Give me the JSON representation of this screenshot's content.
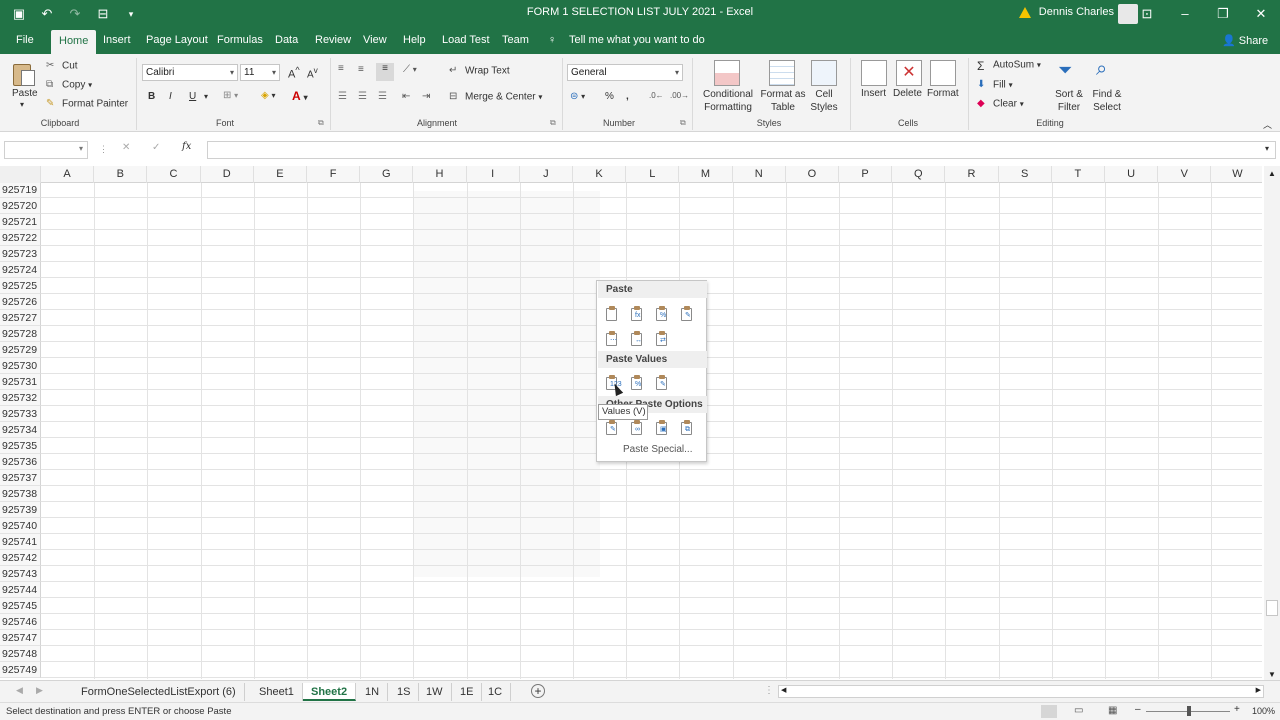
{
  "titlebar": {
    "title": "FORM 1 SELECTION LIST JULY 2021  -  Excel",
    "user": "Dennis Charles",
    "accent": "#217346"
  },
  "tabs": [
    "File",
    "Home",
    "Insert",
    "Page Layout",
    "Formulas",
    "Data",
    "Review",
    "View",
    "Help",
    "Load Test",
    "Team"
  ],
  "tell_me": "Tell me what you want to do",
  "share": "Share",
  "ribbon": {
    "clipboard": {
      "paste": "Paste",
      "cut": "Cut",
      "copy": "Copy",
      "format_painter": "Format Painter",
      "label": "Clipboard"
    },
    "font": {
      "name": "Calibri",
      "size": "11",
      "bold": "B",
      "italic": "I",
      "underline": "U",
      "label": "Font"
    },
    "alignment": {
      "wrap": "Wrap Text",
      "merge": "Merge & Center",
      "label": "Alignment"
    },
    "number": {
      "format": "General",
      "label": "Number"
    },
    "styles": {
      "conditional": "Conditional Formatting",
      "format_table": "Format as Table",
      "cell_styles": "Cell Styles",
      "label": "Styles"
    },
    "cells": {
      "insert": "Insert",
      "delete": "Delete",
      "format": "Format",
      "label": "Cells"
    },
    "editing": {
      "autosum": "AutoSum",
      "fill": "Fill",
      "clear": "Clear",
      "sort": "Sort & Filter",
      "find": "Find & Select",
      "label": "Editing"
    }
  },
  "formula_bar": {
    "name_box": "",
    "fx": "fx",
    "content": ""
  },
  "columns": [
    "A",
    "B",
    "C",
    "D",
    "E",
    "F",
    "G",
    "H",
    "I",
    "J",
    "K",
    "L",
    "M",
    "N",
    "O",
    "P",
    "Q",
    "R",
    "S",
    "T",
    "U",
    "V",
    "W"
  ],
  "rows": [
    "925719",
    "925720",
    "925721",
    "925722",
    "925723",
    "925724",
    "925725",
    "925726",
    "925727",
    "925728",
    "925729",
    "925730",
    "925731",
    "925732",
    "925733",
    "925734",
    "925735",
    "925736",
    "925737",
    "925738",
    "925739",
    "925740",
    "925741",
    "925742",
    "925743",
    "925744",
    "925745",
    "925746",
    "925747",
    "925748",
    "925749"
  ],
  "context_menu": {
    "paste_header": "Paste",
    "paste_values_header": "Paste Values",
    "other_header": "Other Paste Options",
    "paste_special": "Paste Special...",
    "tooltip": "Values (V)"
  },
  "sheets": [
    "FormOneSelectedListExport (6)",
    "Sheet1",
    "Sheet2",
    "1N",
    "1S",
    "1W",
    "1E",
    "1C"
  ],
  "active_sheet": "Sheet2",
  "status": {
    "message": "Select destination and press ENTER or choose Paste",
    "zoom": "100%"
  }
}
